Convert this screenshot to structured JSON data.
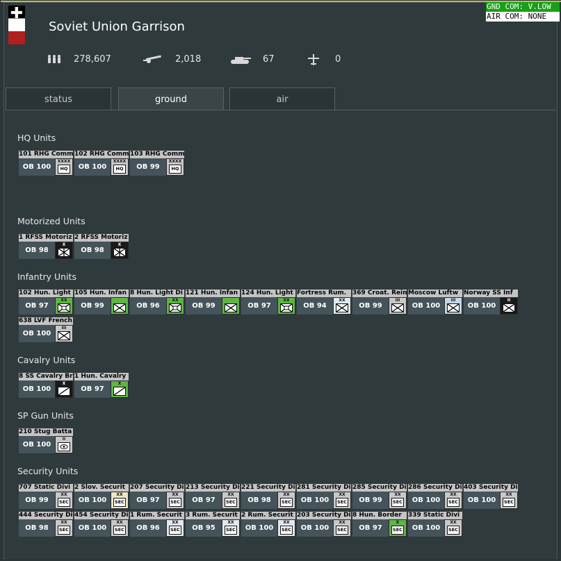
{
  "header": {
    "title": "Soviet Union Garrison",
    "stats": {
      "men": "278,607",
      "guns": "2,018",
      "tanks": "67",
      "aircraft": "0"
    }
  },
  "command": {
    "ground": "GND COM: V.LOW",
    "air": "AIR COM: NONE"
  },
  "tabs": [
    {
      "label": "status",
      "active": false
    },
    {
      "label": "ground",
      "active": true
    },
    {
      "label": "air",
      "active": false
    }
  ],
  "sections": [
    {
      "title": "HQ Units",
      "units": [
        {
          "name": "101 RHG Comm",
          "ob": "OB 100",
          "size": "XXXX",
          "type": "HQ",
          "color": "gray"
        },
        {
          "name": "102 RHG Comm",
          "ob": "OB 100",
          "size": "XXXX",
          "type": "HQ",
          "color": "gray"
        },
        {
          "name": "103 RHG Comm",
          "ob": "OB 99",
          "size": "XXXX",
          "type": "HQ",
          "color": "gray"
        }
      ]
    },
    {
      "title": "Motorized Units",
      "units": [
        {
          "name": "1 RFSS Motoriz",
          "ob": "OB 98",
          "size": "X",
          "type": "motinf",
          "color": "black"
        },
        {
          "name": "2 RFSS Motoriz",
          "ob": "OB 98",
          "size": "X",
          "type": "motinf",
          "color": "black"
        }
      ]
    },
    {
      "title": "Infantry Units",
      "units": [
        {
          "name": "102 Hun. Light",
          "ob": "OB 97",
          "size": "XX",
          "type": "light",
          "color": "green"
        },
        {
          "name": "105 Hun. Infan",
          "ob": "OB 99",
          "size": "",
          "type": "inf",
          "color": "green"
        },
        {
          "name": "8 Hun. Light Di",
          "ob": "OB 96",
          "size": "XX",
          "type": "light",
          "color": "green"
        },
        {
          "name": "121 Hun. Infan",
          "ob": "OB 99",
          "size": "",
          "type": "inf",
          "color": "green"
        },
        {
          "name": "124 Hun. Light",
          "ob": "OB 97",
          "size": "XX",
          "type": "light",
          "color": "green"
        },
        {
          "name": "Fortress Rum.",
          "ob": "OB 94",
          "size": "XX",
          "type": "inf",
          "color": "light"
        },
        {
          "name": "369 Croat. Rein",
          "ob": "OB 99",
          "size": "III",
          "type": "inf",
          "color": "gray"
        },
        {
          "name": "Moscow Luftw",
          "ob": "OB 100",
          "size": "III",
          "type": "inf",
          "color": "lblue"
        },
        {
          "name": "Norway SS Inf",
          "ob": "OB 100",
          "size": "II",
          "type": "inf",
          "color": "black"
        },
        {
          "name": "638 LVF French",
          "ob": "OB 100",
          "size": "III",
          "type": "inf",
          "color": "gray"
        }
      ]
    },
    {
      "title": "Cavalry Units",
      "units": [
        {
          "name": "8 SS Cavalry Br",
          "ob": "OB 100",
          "size": "X",
          "type": "cav",
          "color": "black"
        },
        {
          "name": "1 Hun. Cavalry",
          "ob": "OB 97",
          "size": "X",
          "type": "cav",
          "color": "green"
        }
      ]
    },
    {
      "title": "SP Gun Units",
      "units": [
        {
          "name": "210 Stug Batta",
          "ob": "OB 100",
          "size": "II",
          "type": "spgun",
          "color": "gray"
        }
      ]
    },
    {
      "title": "Security Units",
      "units": [
        {
          "name": "707 Static Divi",
          "ob": "OB 99",
          "size": "XX",
          "type": "SEC",
          "color": "gray"
        },
        {
          "name": "2 Slov. Securit",
          "ob": "OB 100",
          "size": "XX",
          "type": "SEC",
          "color": "cream"
        },
        {
          "name": "207 Security Di",
          "ob": "OB 97",
          "size": "XX",
          "type": "SEC",
          "color": "gray"
        },
        {
          "name": "213 Security Di",
          "ob": "OB 97",
          "size": "XX",
          "type": "SEC",
          "color": "gray"
        },
        {
          "name": "221 Security Di",
          "ob": "OB 98",
          "size": "XX",
          "type": "SEC",
          "color": "gray"
        },
        {
          "name": "281 Security Di",
          "ob": "OB 100",
          "size": "XX",
          "type": "SEC",
          "color": "gray"
        },
        {
          "name": "285 Security Di",
          "ob": "OB 99",
          "size": "XX",
          "type": "SEC",
          "color": "gray"
        },
        {
          "name": "286 Security Di",
          "ob": "OB 100",
          "size": "XX",
          "type": "SEC",
          "color": "gray"
        },
        {
          "name": "403 Security Di",
          "ob": "OB 100",
          "size": "XX",
          "type": "SEC",
          "color": "gray"
        },
        {
          "name": "444 Security Di",
          "ob": "OB 98",
          "size": "XX",
          "type": "SEC",
          "color": "gray"
        },
        {
          "name": "454 Security Di",
          "ob": "OB 100",
          "size": "XX",
          "type": "SEC",
          "color": "gray"
        },
        {
          "name": "1 Rum. Securit",
          "ob": "OB 96",
          "size": "XX",
          "type": "SEC",
          "color": "light"
        },
        {
          "name": "3 Rum. Securit",
          "ob": "OB 95",
          "size": "XX",
          "type": "SEC",
          "color": "light"
        },
        {
          "name": "2 Rum. Securit",
          "ob": "OB 100",
          "size": "XX",
          "type": "SEC",
          "color": "light"
        },
        {
          "name": "203 Security Di",
          "ob": "OB 100",
          "size": "XX",
          "type": "SEC",
          "color": "gray"
        },
        {
          "name": "8 Hun. Border",
          "ob": "OB 97",
          "size": "X",
          "type": "SEC",
          "color": "green"
        },
        {
          "name": "339 Static Divi",
          "ob": "OB 100",
          "size": "XX",
          "type": "SEC",
          "color": "gray"
        }
      ]
    }
  ]
}
